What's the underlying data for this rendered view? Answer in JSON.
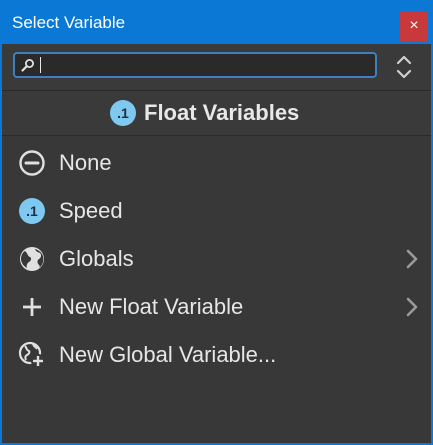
{
  "window": {
    "title": "Select Variable",
    "close_label": "×"
  },
  "search": {
    "value": "",
    "placeholder": ""
  },
  "heading": {
    "badge": ".1",
    "label": "Float Variables"
  },
  "items": [
    {
      "label": "None",
      "icon": "none-circle-icon",
      "has_submenu": false
    },
    {
      "label": "Speed",
      "icon": "float-badge-icon",
      "badge": ".1",
      "has_submenu": false
    },
    {
      "label": "Globals",
      "icon": "globe-icon",
      "has_submenu": true
    },
    {
      "label": "New Float Variable",
      "icon": "plus-icon",
      "has_submenu": true
    },
    {
      "label": "New Global Variable...",
      "icon": "globe-plus-icon",
      "has_submenu": false
    }
  ],
  "colors": {
    "accent": "#0a78d4",
    "close": "#c8393c",
    "badge": "#7ec9f0",
    "background": "#383838"
  }
}
